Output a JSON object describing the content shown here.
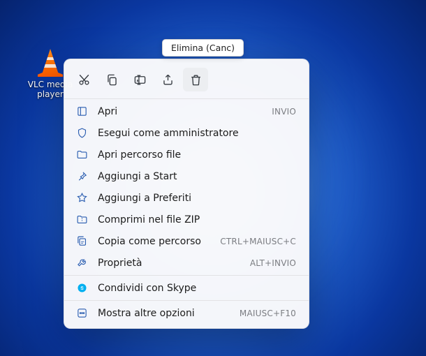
{
  "desktop_icon": {
    "label": "VLC media player",
    "icon_name": "vlc-cone-icon"
  },
  "tooltip": {
    "text": "Elimina (Canc)"
  },
  "icon_row": {
    "cut": "cut-icon",
    "copy": "copy-icon",
    "rename": "rename-icon",
    "share": "share-icon",
    "delete": "delete-icon"
  },
  "menu": {
    "open": {
      "label": "Apri",
      "shortcut": "INVIO"
    },
    "run_admin": {
      "label": "Esegui come amministratore",
      "shortcut": ""
    },
    "open_location": {
      "label": "Apri percorso file",
      "shortcut": ""
    },
    "pin_start": {
      "label": "Aggiungi a Start",
      "shortcut": ""
    },
    "pin_favorites": {
      "label": "Aggiungi a Preferiti",
      "shortcut": ""
    },
    "compress_zip": {
      "label": "Comprimi nel file ZIP",
      "shortcut": ""
    },
    "copy_as_path": {
      "label": "Copia come percorso",
      "shortcut": "CTRL+MAIUSC+C"
    },
    "properties": {
      "label": "Proprietà",
      "shortcut": "ALT+INVIO"
    },
    "share_skype": {
      "label": "Condividi con Skype",
      "shortcut": ""
    },
    "show_more": {
      "label": "Mostra altre opzioni",
      "shortcut": "MAIUSC+F10"
    }
  },
  "colors": {
    "accent_blue": "#2a5db0",
    "skype_blue": "#00aff0",
    "text_muted": "#7b7d82"
  }
}
